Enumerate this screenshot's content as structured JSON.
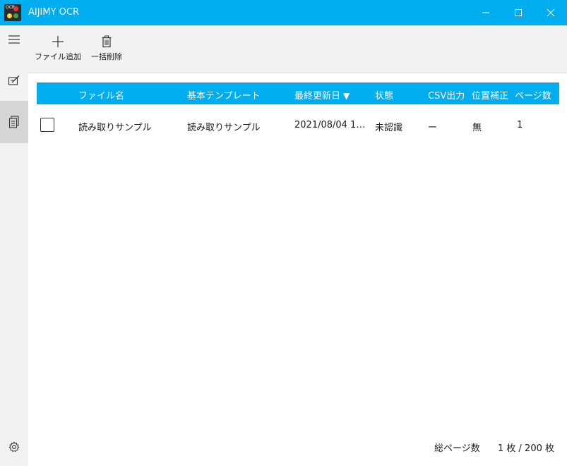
{
  "window": {
    "title": "AIJIMY OCR",
    "icon_text": "OCR",
    "accent_color": "#00adef"
  },
  "nav": {
    "items": [
      {
        "name": "hamburger-menu-icon"
      },
      {
        "name": "edit-document-icon"
      },
      {
        "name": "documents-icon",
        "selected": true
      },
      {
        "name": "gear-icon"
      }
    ]
  },
  "toolbar": {
    "add_label": "ファイル追加",
    "delete_label": "一括削除"
  },
  "table": {
    "columns": [
      "ファイル名",
      "基本テンプレート",
      "最終更新日",
      "状態",
      "CSV出力",
      "位置補正",
      "ページ数"
    ],
    "sorted_column": "最終更新日",
    "sort_direction": "desc",
    "sort_glyph": "▼",
    "rows": [
      {
        "checked": false,
        "name": "読み取りサンプル",
        "template": "読み取りサンプル",
        "updated": "2021/08/04 13:...",
        "status": "未認識",
        "csv": "ー",
        "position": "無",
        "pages": "1"
      }
    ]
  },
  "footer": {
    "total_label": "総ページ数",
    "count": "1 枚 / 200 枚"
  }
}
